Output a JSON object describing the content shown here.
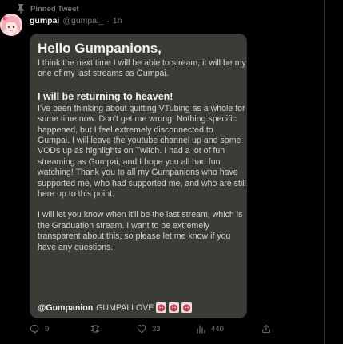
{
  "pinned": {
    "label": "Pinned Tweet"
  },
  "author": {
    "name": "gumpai",
    "handle": "@gumpai_",
    "separator": "·",
    "time": "1h"
  },
  "image": {
    "greeting": "Hello Gumpanions,",
    "intro": "I think the next time I will be able to stream, it will be my one of my last streams as Gumpai.",
    "heading": "I will be returning to heaven!",
    "body1": "I've been thinking about quitting VTubing as a whole for some time now. Don't get me wrong! Nothing specific happened, but I feel extremely disconnected to Gumpai. I will leave the youtube channel up and some VODs up as highlights on Twitch. I had a lot of fun streaming as Gumpai, and I hope you all had fun watching! Thank you to all my Gumpanions who have supported me, who had supported me, and who are still here up to this point.",
    "body2": "I will let you know when it'll be the last stream, which is the Graduation stream. I want to be extremely transparent about this, so please let me know if you have any questions.",
    "mention": "@Gumpanion",
    "signoff": "GUMPAI LOVE"
  },
  "actions": {
    "replies": "9",
    "retweets": "",
    "likes": "33",
    "views": "440"
  },
  "colors": {
    "accent": "#1d9bf0",
    "muted": "#71767b",
    "card": "#3c3c36"
  }
}
